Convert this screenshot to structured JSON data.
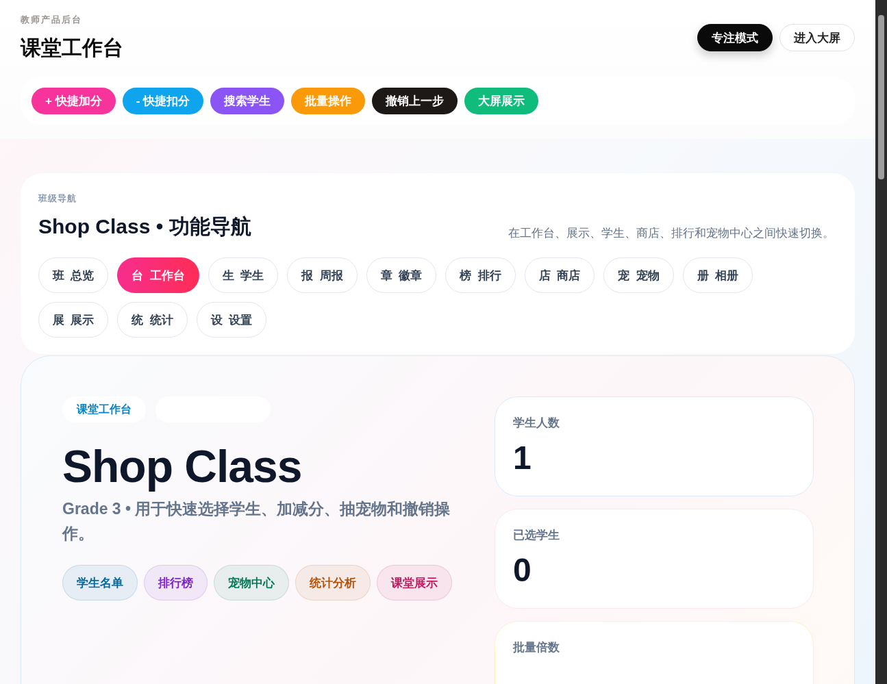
{
  "header": {
    "eyebrow": "教师产品后台",
    "title": "课堂工作台",
    "buttons": [
      {
        "label": "专注模式",
        "kind": "primary"
      },
      {
        "label": "进入大屏",
        "kind": "outline"
      }
    ]
  },
  "quick_actions": [
    {
      "label": "+ 快捷加分",
      "color": "#f7349b"
    },
    {
      "label": "- 快捷扣分",
      "color": "#0ea5ee"
    },
    {
      "label": "搜索学生",
      "color": "#8b55f6"
    },
    {
      "label": "批量操作",
      "color": "#fb9a08"
    },
    {
      "label": "撤销上一步",
      "color": "#1c1917"
    },
    {
      "label": "大屏展示",
      "color": "#10bc7c"
    }
  ],
  "nav": {
    "eyebrow": "班级导航",
    "title": "Shop Class • 功能导航",
    "hint": "在工作台、展示、学生、商店、排行和宠物中心之间快速切换。",
    "items": [
      {
        "glyph": "班",
        "label": "总览",
        "selected": false
      },
      {
        "glyph": "台",
        "label": "工作台",
        "selected": true
      },
      {
        "glyph": "生",
        "label": "学生",
        "selected": false
      },
      {
        "glyph": "报",
        "label": "周报",
        "selected": false
      },
      {
        "glyph": "章",
        "label": "徽章",
        "selected": false
      },
      {
        "glyph": "榜",
        "label": "排行",
        "selected": false
      },
      {
        "glyph": "店",
        "label": "商店",
        "selected": false
      },
      {
        "glyph": "宠",
        "label": "宠物",
        "selected": false
      },
      {
        "glyph": "册",
        "label": "相册",
        "selected": false
      },
      {
        "glyph": "展",
        "label": "展示",
        "selected": false
      },
      {
        "glyph": "统",
        "label": "统计",
        "selected": false
      },
      {
        "glyph": "设",
        "label": "设置",
        "selected": false
      }
    ]
  },
  "hero": {
    "tag": "课堂工作台",
    "title": "Shop Class",
    "subtitle": "Grade 3 • 用于快速选择学生、加减分、抽宠物和撤销操作。",
    "links": [
      {
        "label": "学生名单",
        "color": "#0369a1"
      },
      {
        "label": "排行榜",
        "color": "#7e22ce"
      },
      {
        "label": "宠物中心",
        "color": "#047857"
      },
      {
        "label": "统计分析",
        "color": "#b45309"
      },
      {
        "label": "课堂展示",
        "color": "#be185d"
      }
    ]
  },
  "stats": [
    {
      "label": "学生人数",
      "value": "1",
      "color": "#dbeafe"
    },
    {
      "label": "已选学生",
      "value": "0",
      "color": "#fce7f3"
    },
    {
      "label": "批量倍数",
      "color": "#fef3c7"
    }
  ]
}
